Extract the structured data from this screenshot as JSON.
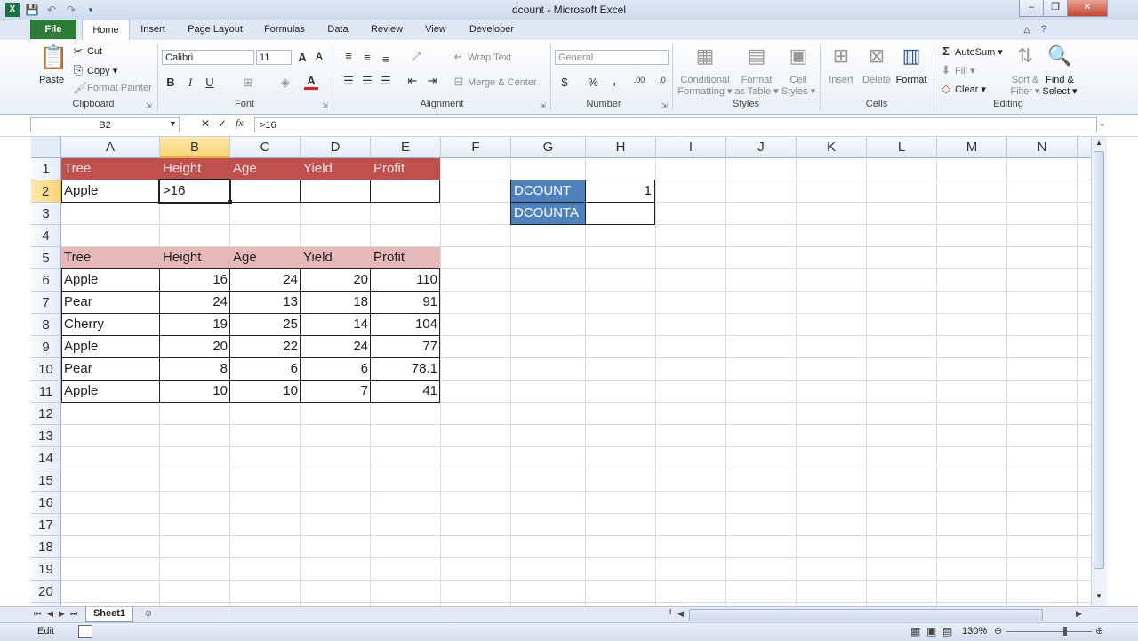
{
  "window": {
    "title": "dcount - Microsoft Excel",
    "minimize": "–",
    "restore": "❐",
    "close": "✕"
  },
  "tabs": [
    "File",
    "Home",
    "Insert",
    "Page Layout",
    "Formulas",
    "Data",
    "Review",
    "View",
    "Developer"
  ],
  "ribbon": {
    "clipboard": {
      "paste": "Paste",
      "cut": "Cut",
      "copy": "Copy ▾",
      "format_painter": "Format Painter",
      "label": "Clipboard"
    },
    "font": {
      "name": "Calibri",
      "size": "11",
      "bold": "B",
      "italic": "I",
      "underline": "U",
      "label": "Font"
    },
    "alignment": {
      "wrap_text": "Wrap Text",
      "merge_center": "Merge & Center",
      "label": "Alignment"
    },
    "number": {
      "format": "General",
      "currency": "$",
      "percent": "%",
      "comma": ",",
      "label": "Number"
    },
    "styles": {
      "conditional_1": "Conditional",
      "conditional_2": "Formatting ▾",
      "format_table_1": "Format",
      "format_table_2": "as Table ▾",
      "cell_styles_1": "Cell",
      "cell_styles_2": "Styles ▾",
      "label": "Styles"
    },
    "cells": {
      "insert": "Insert",
      "delete": "Delete",
      "format": "Format",
      "label": "Cells"
    },
    "editing": {
      "autosum": "AutoSum ▾",
      "fill": "Fill ▾",
      "clear": "Clear ▾",
      "sort_1": "Sort &",
      "sort_2": "Filter ▾",
      "find_1": "Find &",
      "find_2": "Select ▾",
      "label": "Editing"
    }
  },
  "formula_bar": {
    "name_box": "B2",
    "cancel": "✕",
    "enter": "✓",
    "fx": "fx",
    "value": ">16"
  },
  "columns": [
    "A",
    "B",
    "C",
    "D",
    "E",
    "F",
    "G",
    "H",
    "I",
    "J",
    "K",
    "L",
    "M",
    "N"
  ],
  "rows": [
    "1",
    "2",
    "3",
    "4",
    "5",
    "6",
    "7",
    "8",
    "9",
    "10",
    "11",
    "12",
    "13",
    "14",
    "15",
    "16",
    "17",
    "18",
    "19",
    "20",
    "21"
  ],
  "criteria": {
    "headers": [
      "Tree",
      "Height",
      "Age",
      "Yield",
      "Profit"
    ],
    "values": [
      "Apple",
      ">16",
      "",
      "",
      ""
    ]
  },
  "table": {
    "headers": [
      "Tree",
      "Height",
      "Age",
      "Yield",
      "Profit"
    ],
    "rows": [
      [
        "Apple",
        "16",
        "24",
        "20",
        "110"
      ],
      [
        "Pear",
        "24",
        "13",
        "18",
        "91"
      ],
      [
        "Cherry",
        "19",
        "25",
        "14",
        "104"
      ],
      [
        "Apple",
        "20",
        "22",
        "24",
        "77"
      ],
      [
        "Pear",
        "8",
        "6",
        "6",
        "78.1"
      ],
      [
        "Apple",
        "10",
        "10",
        "7",
        "41"
      ]
    ]
  },
  "results": {
    "dcount_label": "DCOUNT",
    "dcount_value": "1",
    "dcounta_label": "DCOUNTA",
    "dcounta_value": ""
  },
  "sheets": {
    "active": "Sheet1"
  },
  "status": {
    "mode": "Edit",
    "zoom": "130%"
  },
  "colors": {
    "header_dark": "#c0504d",
    "header_light": "#e6b9b8",
    "result_blue": "#4f81bd",
    "file_tab": "#2c7c37"
  }
}
